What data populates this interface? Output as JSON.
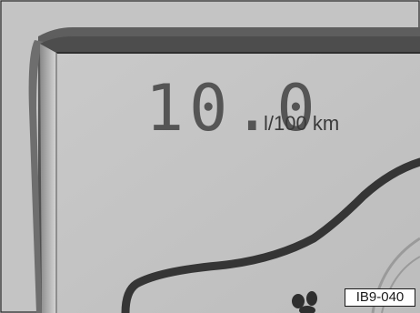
{
  "display": {
    "reading": "10.0",
    "unit": "l/100 km"
  },
  "figure": {
    "code": "IB9-040"
  },
  "colors": {
    "bezel": "#555555",
    "screen": "#c2c2c2",
    "digits": "#555555",
    "outline": "#333333"
  },
  "icons": [
    "car-outline-icon",
    "footprint-icon"
  ]
}
